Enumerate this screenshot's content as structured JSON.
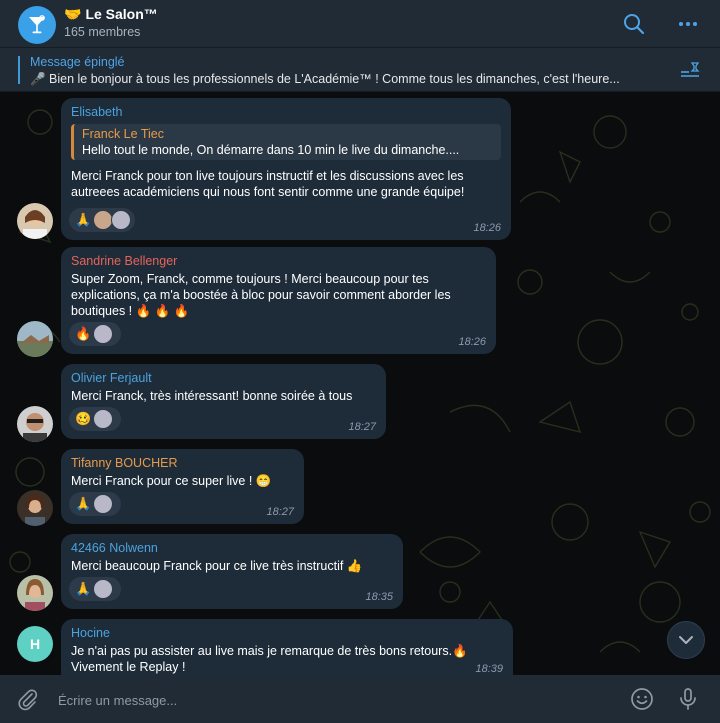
{
  "header": {
    "title_emoji": "🤝",
    "title": "Le Salon™",
    "subtitle": "165 membres"
  },
  "pinned": {
    "title": "Message épinglé",
    "text": "🎤 Bien le bonjour à tous les professionnels de L'Académie™ !  Comme tous les dimanches, c'est l'heure..."
  },
  "messages": [
    {
      "sender": "Elisabeth",
      "sender_color": "#4aa3df",
      "reply": {
        "name": "Franck Le Tiec",
        "text": "Hello tout le monde, On démarre dans 10 min le live du dimanche...."
      },
      "text": "Merci Franck pour ton live toujours instructif et les discussions avec les autreees académiciens qui nous font sentir comme une grande équipe!",
      "reaction": "🙏",
      "time": "18:26"
    },
    {
      "sender": "Sandrine Bellenger",
      "sender_color": "#e5645a",
      "text": "Super Zoom, Franck, comme toujours ! Merci beaucoup pour tes explications, ça m'a boostée à bloc pour savoir comment aborder les boutiques ! 🔥 🔥 🔥",
      "reaction": "🔥",
      "time": "18:26"
    },
    {
      "sender": "Olivier Ferjault",
      "sender_color": "#4aa3df",
      "text": "Merci Franck, très intéressant! bonne soirée à tous",
      "reaction": "🥴",
      "time": "18:27"
    },
    {
      "sender": "Tifanny BOUCHER",
      "sender_color": "#e89a4a",
      "text": "Merci Franck pour ce super live  ! 😁",
      "reaction": "🙏",
      "time": "18:27"
    },
    {
      "sender": "42466 Nolwenn",
      "sender_color": "#4aa3df",
      "text": "Merci beaucoup Franck pour ce live très instructif 👍",
      "reaction": "🙏",
      "time": "18:35"
    },
    {
      "sender": "Hocine",
      "sender_color": "#4aa3df",
      "avatar_letter": "H",
      "text": "Je n'ai pas pu assister au live mais je remarque de très bons retours.🔥 Vivement le Replay !",
      "time": "18:39"
    }
  ],
  "composer": {
    "placeholder": "Écrire un message..."
  },
  "colors": {
    "header_bg": "#202b36",
    "bubble_bg": "#1e2c3a",
    "accent": "#4ea4e6"
  }
}
